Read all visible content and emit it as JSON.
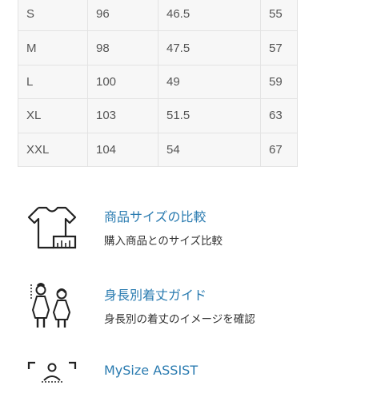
{
  "size_table": {
    "rows": [
      [
        "S",
        "96",
        "46.5",
        "55"
      ],
      [
        "M",
        "98",
        "47.5",
        "57"
      ],
      [
        "L",
        "100",
        "49",
        "59"
      ],
      [
        "XL",
        "103",
        "51.5",
        "63"
      ],
      [
        "XXL",
        "104",
        "54",
        "67"
      ]
    ]
  },
  "features": [
    {
      "icon": "tshirt-ruler-icon",
      "title": "商品サイズの比較",
      "description": "購入商品とのサイズ比較"
    },
    {
      "icon": "body-length-people-icon",
      "title": "身長別着丈ガイド",
      "description": "身長別の着丈のイメージを確認"
    },
    {
      "icon": "body-scan-icon",
      "title": "MySize ASSIST",
      "description": ""
    }
  ],
  "colors": {
    "link": "#2a7bb0",
    "table_bg": "#f7f7f7",
    "table_border": "#e3e3e3"
  }
}
